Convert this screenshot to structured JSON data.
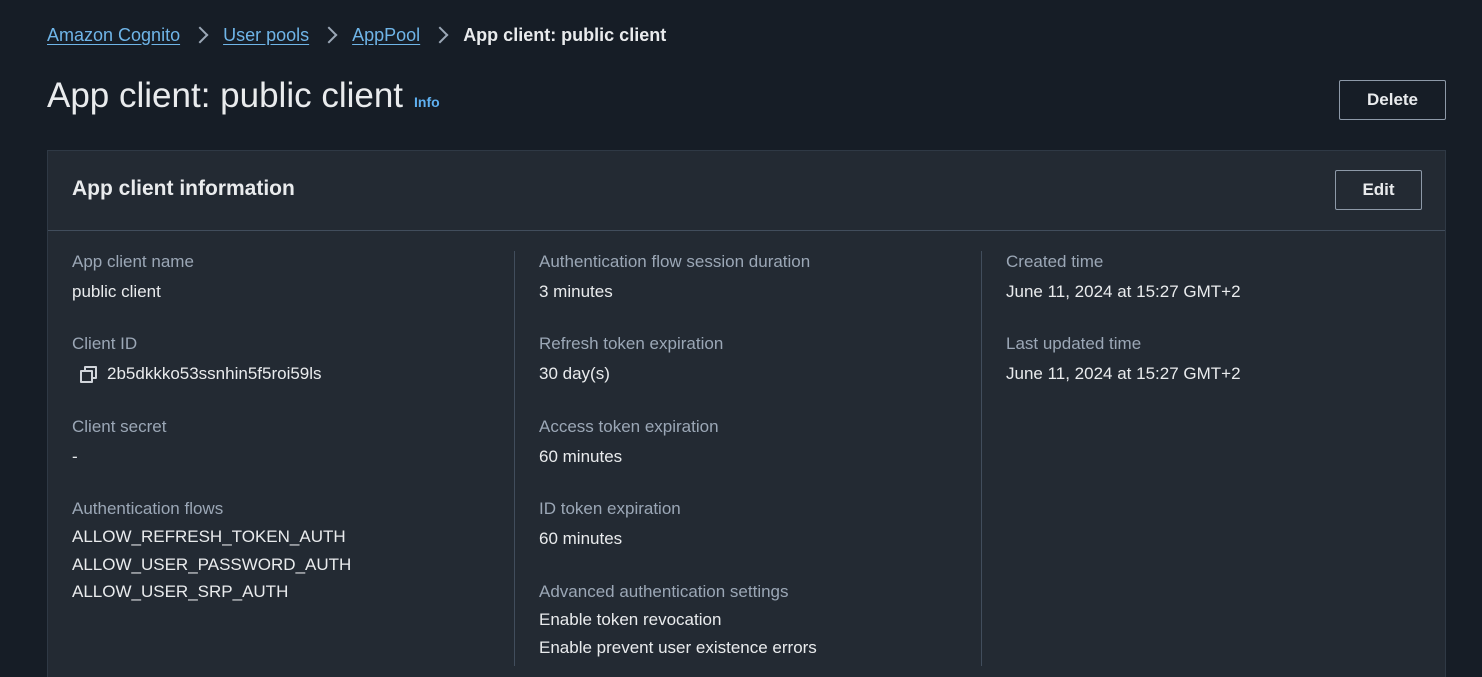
{
  "breadcrumb": {
    "items": [
      "Amazon Cognito",
      "User pools",
      "AppPool"
    ],
    "current": "App client: public client"
  },
  "header": {
    "title": "App client: public client",
    "info_label": "Info",
    "delete_label": "Delete"
  },
  "card": {
    "title": "App client information",
    "edit_label": "Edit",
    "col1": {
      "app_client_name_label": "App client name",
      "app_client_name": "public client",
      "client_id_label": "Client ID",
      "client_id": "2b5dkkko53ssnhin5f5roi59ls",
      "client_secret_label": "Client secret",
      "client_secret": "-",
      "auth_flows_label": "Authentication flows",
      "auth_flows": [
        "ALLOW_REFRESH_TOKEN_AUTH",
        "ALLOW_USER_PASSWORD_AUTH",
        "ALLOW_USER_SRP_AUTH"
      ]
    },
    "col2": {
      "session_duration_label": "Authentication flow session duration",
      "session_duration": "3 minutes",
      "refresh_expiration_label": "Refresh token expiration",
      "refresh_expiration": "30 day(s)",
      "access_expiration_label": "Access token expiration",
      "access_expiration": "60 minutes",
      "id_expiration_label": "ID token expiration",
      "id_expiration": "60 minutes",
      "advanced_label": "Advanced authentication settings",
      "advanced": [
        "Enable token revocation",
        "Enable prevent user existence errors"
      ]
    },
    "col3": {
      "created_label": "Created time",
      "created": "June 11, 2024 at 15:27 GMT+2",
      "updated_label": "Last updated time",
      "updated": "June 11, 2024 at 15:27 GMT+2"
    }
  },
  "icons": {
    "breadcrumb_separator": "chevron-right-icon",
    "copy": "copy-icon"
  },
  "colors": {
    "background": "#161d26",
    "card": "#232a33",
    "link": "#6fb5e8",
    "label": "#9ba7b6",
    "text": "#e9ebed"
  }
}
